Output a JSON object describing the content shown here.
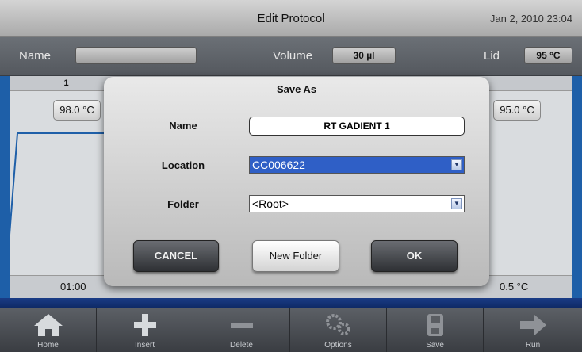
{
  "header": {
    "title": "Edit Protocol",
    "datetime": "Jan 2, 2010 23:04"
  },
  "params": {
    "name_label": "Name",
    "name_value": "",
    "volume_label": "Volume",
    "volume_value": "30 µl",
    "lid_label": "Lid",
    "lid_value": "95 °C"
  },
  "protocol": {
    "step_number": "1",
    "step1_temp": "98.0 °C",
    "step_right_temp": "95.0 °C",
    "step1_time": "01:00",
    "step_right_rate": "0.5 °C",
    "colors": {
      "stripe": "#1e5fa8",
      "bottom_bar": "#1a3c86"
    }
  },
  "dialog": {
    "title": "Save As",
    "name_label": "Name",
    "name_value": "RT GADIENT 1",
    "location_label": "Location",
    "location_value": "CC006622",
    "folder_label": "Folder",
    "folder_value": "<Root>",
    "cancel_label": "CANCEL",
    "new_folder_label": "New Folder",
    "ok_label": "OK",
    "accent": "#2f5fc6"
  },
  "toolbar": {
    "items": [
      {
        "label": "Home",
        "icon": "home-icon"
      },
      {
        "label": "Insert",
        "icon": "plus-icon"
      },
      {
        "label": "Delete",
        "icon": "minus-icon"
      },
      {
        "label": "Options",
        "icon": "gears-icon"
      },
      {
        "label": "Save",
        "icon": "save-icon"
      },
      {
        "label": "Run",
        "icon": "arrow-right-icon"
      }
    ]
  }
}
